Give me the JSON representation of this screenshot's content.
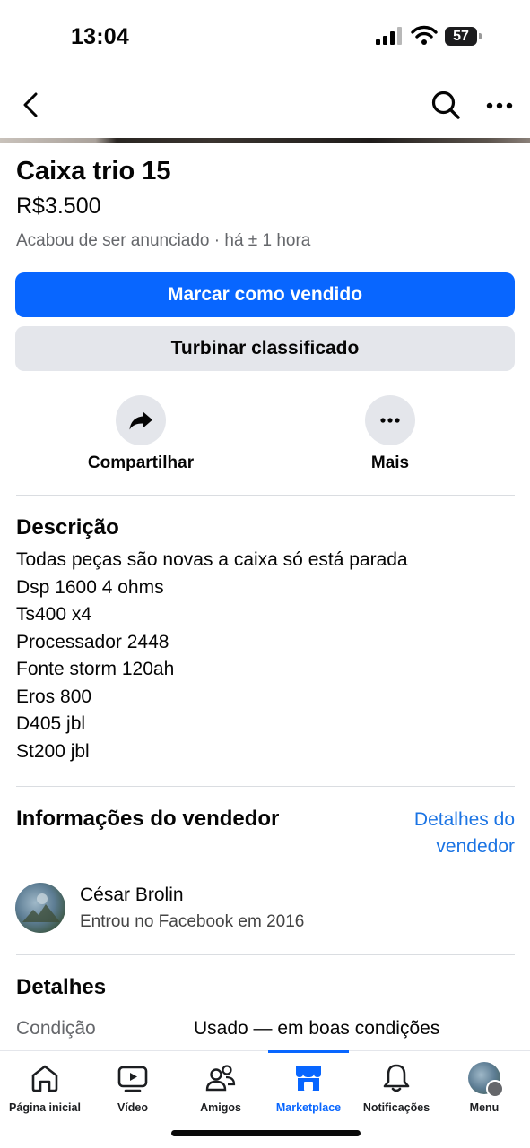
{
  "status_bar": {
    "time": "13:04",
    "battery": "57"
  },
  "nav": {
    "back_icon": "chevron-left-icon",
    "search_icon": "search-icon",
    "more_icon": "more-horizontal-icon"
  },
  "listing": {
    "title": "Caixa trio 15",
    "price": "R$3.500",
    "posted": "Acabou de ser anunciado  · há ± 1 hora",
    "primary_button": "Marcar como vendido",
    "secondary_button": "Turbinar classificado"
  },
  "actions": {
    "share_label": "Compartilhar",
    "more_label": "Mais"
  },
  "description": {
    "heading": "Descrição",
    "lines": [
      "Todas peças são novas a caixa só está parada",
      "Dsp 1600 4 ohms",
      "Ts400 x4",
      "Processador 2448",
      "Fonte storm 120ah",
      "Eros 800",
      "D405 jbl",
      "St200 jbl"
    ]
  },
  "seller": {
    "heading": "Informações do vendedor",
    "details_link_line1": "Detalhes do",
    "details_link_line2": "vendedor",
    "name": "César Brolin",
    "joined": "Entrou no Facebook em 2016"
  },
  "details": {
    "heading": "Detalhes",
    "condition_label": "Condição",
    "condition_value": "Usado — em boas condições"
  },
  "tabs": [
    {
      "label": "Página inicial",
      "icon": "home-icon"
    },
    {
      "label": "Vídeo",
      "icon": "video-icon"
    },
    {
      "label": "Amigos",
      "icon": "friends-icon"
    },
    {
      "label": "Marketplace",
      "icon": "marketplace-icon",
      "active": true
    },
    {
      "label": "Notificações",
      "icon": "bell-icon"
    },
    {
      "label": "Menu",
      "icon": "profile-avatar"
    }
  ],
  "colors": {
    "accent": "#0866ff",
    "link": "#1b74e4",
    "secondary_bg": "#e4e6eb",
    "muted_text": "#65676b"
  }
}
